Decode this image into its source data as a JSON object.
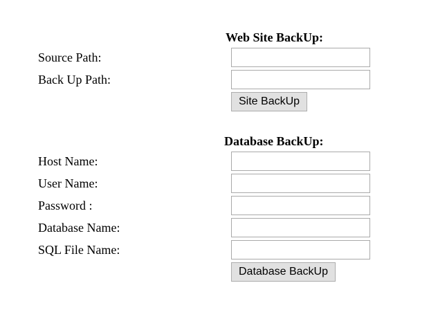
{
  "site_backup": {
    "heading": "Web Site BackUp:",
    "source_path_label": "Source Path:",
    "source_path_value": "",
    "backup_path_label": "Back Up Path:",
    "backup_path_value": "",
    "button_label": "Site BackUp"
  },
  "database_backup": {
    "heading": "Database BackUp:",
    "host_name_label": "Host Name:",
    "host_name_value": "",
    "user_name_label": "User Name:",
    "user_name_value": "",
    "password_label": "Password :",
    "password_value": "",
    "database_name_label": "Database Name:",
    "database_name_value": "",
    "sql_file_name_label": "SQL File Name:",
    "sql_file_name_value": "",
    "button_label": "Database BackUp"
  }
}
